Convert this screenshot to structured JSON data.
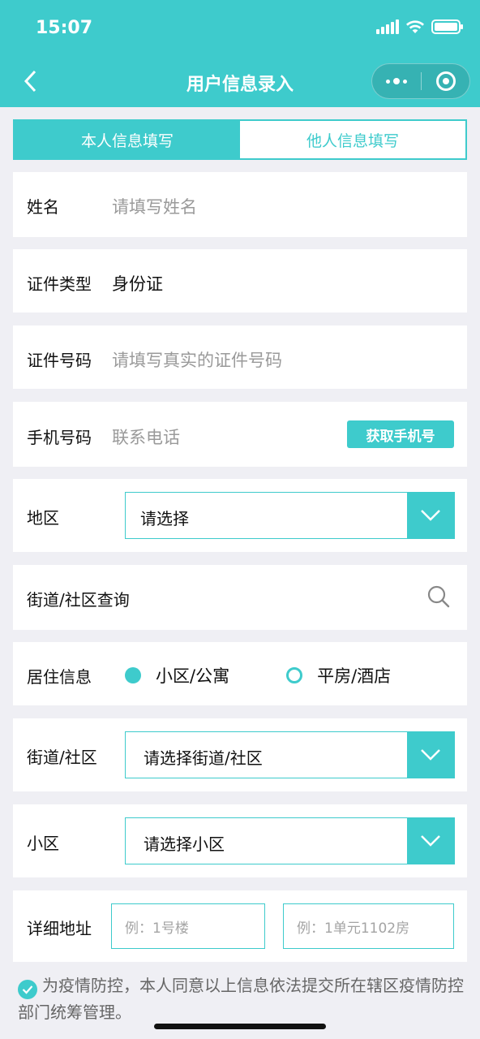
{
  "status_bar": {
    "time": "15:07"
  },
  "nav": {
    "title": "用户信息录入"
  },
  "tabs": [
    {
      "label": "本人信息填写"
    },
    {
      "label": "他人信息填写"
    }
  ],
  "form": {
    "name": {
      "label": "姓名",
      "placeholder": "请填写姓名"
    },
    "id_type": {
      "label": "证件类型",
      "value": "身份证"
    },
    "id_number": {
      "label": "证件号码",
      "placeholder": "请填写真实的证件号码"
    },
    "phone": {
      "label": "手机号码",
      "placeholder": "联系电话",
      "button": "获取手机号"
    },
    "region": {
      "label": "地区",
      "selected": "请选择"
    },
    "street_search": {
      "label": "街道/社区查询"
    },
    "residence": {
      "label": "居住信息",
      "options": [
        {
          "label": "小区/公寓",
          "checked": true
        },
        {
          "label": "平房/酒店",
          "checked": false
        }
      ]
    },
    "street": {
      "label": "街道/社区",
      "selected": "请选择街道/社区"
    },
    "community": {
      "label": "小区",
      "selected": "请选择小区"
    },
    "address": {
      "label": "详细地址",
      "building_placeholder": "例：1号楼",
      "unit_placeholder": "例：1单元1102房"
    }
  },
  "consent": {
    "text": "为疫情防控，本人同意以上信息依法提交所在辖区疫情防控部门统筹管理。",
    "checked": true
  },
  "colors": {
    "accent": "#3ecbcc"
  }
}
